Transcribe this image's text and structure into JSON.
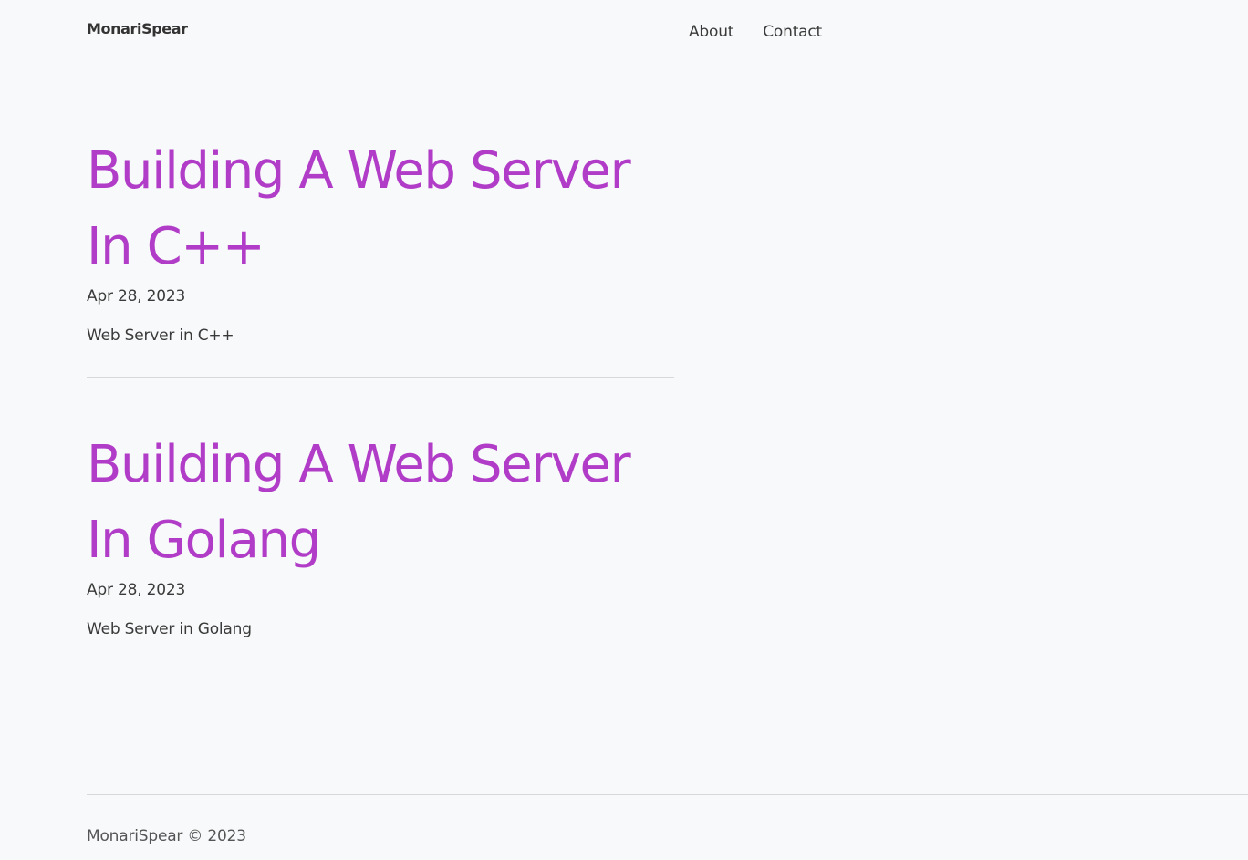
{
  "header": {
    "brand": "MonariSpear",
    "nav": [
      {
        "label": "About"
      },
      {
        "label": "Contact"
      }
    ]
  },
  "posts": [
    {
      "title": "Building A Web Server In C++",
      "date": "Apr 28, 2023",
      "description": "Web Server in C++"
    },
    {
      "title": "Building A Web Server In Golang",
      "date": "Apr 28, 2023",
      "description": "Web Server in Golang"
    }
  ],
  "footer": {
    "text": "MonariSpear © 2023"
  },
  "colors": {
    "accent": "#b03cc7",
    "background": "#f8f9fa",
    "text": "#3a3a3a"
  }
}
